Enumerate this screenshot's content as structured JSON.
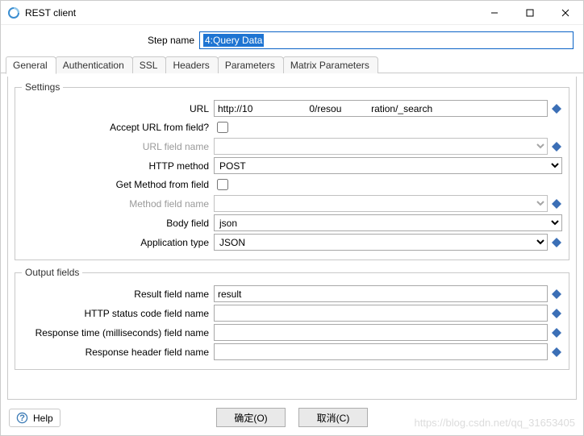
{
  "window": {
    "title": "REST client"
  },
  "stepname": {
    "label": "Step name",
    "value": "4:Query Data"
  },
  "tabs": {
    "general": "General",
    "authentication": "Authentication",
    "ssl": "SSL",
    "headers": "Headers",
    "parameters": "Parameters",
    "matrix": "Matrix Parameters"
  },
  "settings": {
    "legend": "Settings",
    "url_label": "URL",
    "url_value": "http://10                     0/resou           ration/_search",
    "accept_url_label": "Accept URL from field?",
    "accept_url_checked": false,
    "url_field_label": "URL field name",
    "url_field_value": "",
    "http_method_label": "HTTP method",
    "http_method_value": "POST",
    "get_method_label": "Get Method from field",
    "get_method_checked": false,
    "method_field_label": "Method field name",
    "method_field_value": "",
    "body_field_label": "Body field",
    "body_field_value": "json",
    "app_type_label": "Application type",
    "app_type_value": "JSON"
  },
  "output": {
    "legend": "Output fields",
    "result_label": "Result field name",
    "result_value": "result",
    "status_label": "HTTP status code field name",
    "status_value": "",
    "time_label": "Response time (milliseconds) field name",
    "time_value": "",
    "header_label": "Response header field name",
    "header_value": ""
  },
  "buttons": {
    "ok": "确定(O)",
    "cancel": "取消(C)"
  },
  "help": {
    "label": "Help"
  },
  "watermark": "https://blog.csdn.net/qq_31653405"
}
